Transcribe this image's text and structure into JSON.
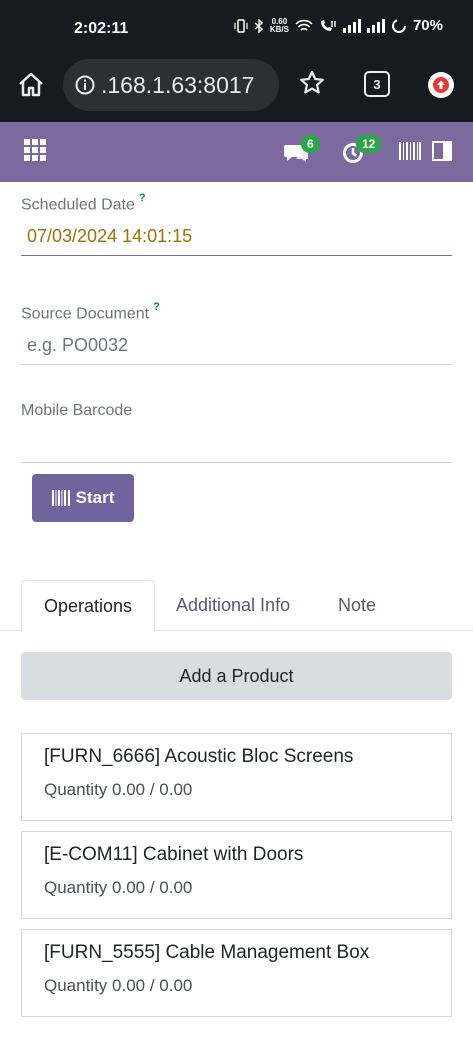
{
  "status_bar": {
    "time": "2:02:11",
    "netspeed_value": "0.60",
    "netspeed_unit": "KB/S",
    "battery": "70%"
  },
  "browser": {
    "url": ".168.1.63:8017",
    "tab_count": "3",
    "icons": [
      "home-icon",
      "info-icon",
      "star-icon",
      "tabs-icon",
      "update-icon"
    ]
  },
  "navbar": {
    "color": "#7c6a9e",
    "messages_badge": "6",
    "activities_badge": "12",
    "icons": [
      "apps-grid-icon",
      "chat-icon",
      "clock-icon",
      "barcode-icon",
      "panel-icon"
    ]
  },
  "form": {
    "scheduled_date": {
      "label": "Scheduled Date",
      "help": "?",
      "value": "07/03/2024 14:01:15"
    },
    "source_document": {
      "label": "Source Document",
      "help": "?",
      "placeholder": "e.g. PO0032"
    },
    "mobile_barcode": {
      "label": "Mobile Barcode",
      "value": ""
    },
    "start_label": "Start"
  },
  "tabs": [
    {
      "label": "Operations",
      "active": true
    },
    {
      "label": "Additional Info",
      "active": false
    },
    {
      "label": "Note",
      "active": false
    }
  ],
  "add_product_label": "Add a Product",
  "operations": [
    {
      "name": "[FURN_6666] Acoustic Bloc Screens",
      "quantity": "Quantity 0.00 / 0.00"
    },
    {
      "name": "[E-COM11] Cabinet with Doors",
      "quantity": "Quantity 0.00 / 0.00"
    },
    {
      "name": "[FURN_5555] Cable Management Box",
      "quantity": "Quantity 0.00 / 0.00"
    }
  ]
}
